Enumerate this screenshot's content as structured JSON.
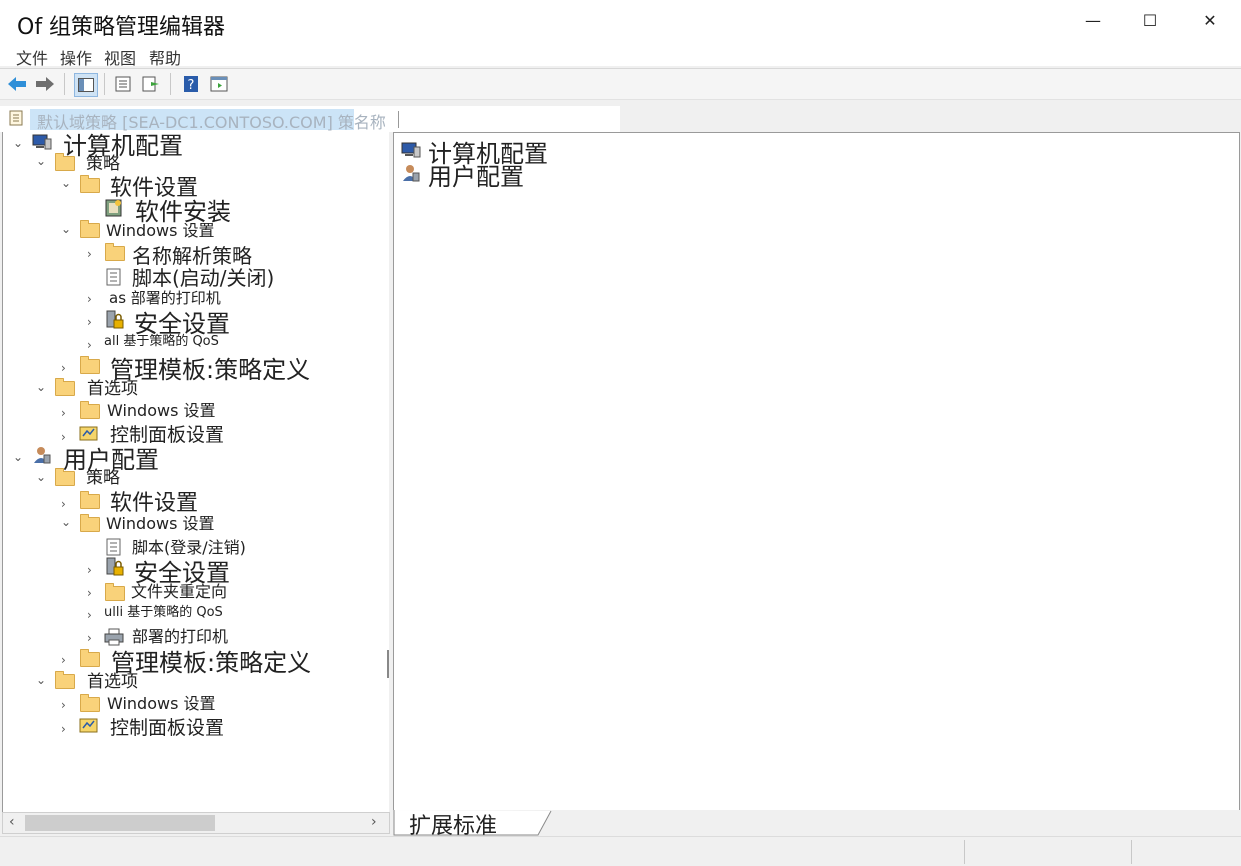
{
  "window": {
    "title": "Of 组策略管理编辑器",
    "controls": {
      "minimize": "—",
      "maximize": "☐",
      "close": "✕"
    }
  },
  "menu": [
    "文件",
    "操作",
    "视图",
    "帮助"
  ],
  "path": "默认域策略 [SEA-DC1.CONTOSO.COM] 策名称",
  "tree": {
    "computer": {
      "label": "计算机配置",
      "policies": "策略",
      "software_settings": "软件设置",
      "software_install": "软件安装",
      "windows_settings": "Windows 设置",
      "name_resolution": "名称解析策略",
      "scripts": "脚本(启动/关闭)",
      "printers": "as 部署的打印机",
      "security": "安全设置",
      "qos": "all 基于策略的 QoS",
      "admin_templates": "管理模板:策略定义",
      "preferences": "首选项",
      "pref_windows": "Windows 设置",
      "pref_control": "控制面板设置"
    },
    "user": {
      "label": "用户配置",
      "policies": "策略",
      "software_settings": "软件设置",
      "windows_settings": "Windows 设置",
      "scripts": "脚本(登录/注销)",
      "security": "安全设置",
      "folder_redirect": "文件夹重定向",
      "qos": "ulli 基于策略的 QoS",
      "printers": "部署的打印机",
      "admin_templates": "管理模板:策略定义",
      "preferences": "首选项",
      "pref_windows": "Windows 设置",
      "pref_control": "控制面板设置"
    }
  },
  "right_items": [
    "计算机配置",
    "用户配置"
  ],
  "tabs": [
    "扩展",
    "标准"
  ]
}
